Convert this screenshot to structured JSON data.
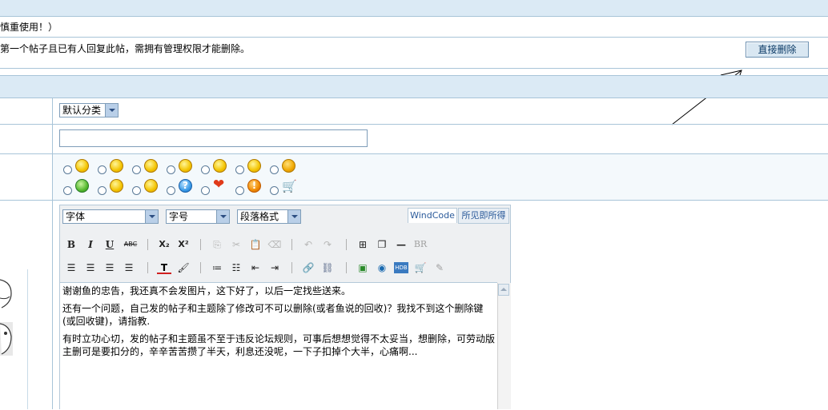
{
  "notice": {
    "line1": "慎重使用！）",
    "line2": "第一个帖子且已有人回复此帖，需拥有管理权限才能删除。",
    "delete_button": "直接删除"
  },
  "form": {
    "category_selected": "默认分类",
    "title_value": ""
  },
  "emoticons_row1": [
    "smile",
    "grin",
    "blush",
    "wink",
    "surprised",
    "laugh",
    "angry"
  ],
  "emoticons_row2": [
    "sick",
    "cry",
    "cool",
    "question",
    "heart",
    "warning",
    "cart"
  ],
  "editor": {
    "font_label": "字体",
    "size_label": "字号",
    "paragraph_label": "段落格式",
    "mode_windcode": "WindCode",
    "mode_wysiwyg": "所见即所得",
    "toolbar": {
      "bold": "B",
      "italic": "I",
      "underline": "U",
      "strike": "ABC",
      "subscript": "X₂",
      "superscript": "X²",
      "hr": "—",
      "br": "BR"
    },
    "content": [
      "谢谢鱼的忠告，我还真不会发图片，这下好了，以后一定找些送来。",
      "还有一个问题，自己发的帖子和主题除了修改可不可以删除(或者鱼说的回收)？我找不到这个删除键(或回收键)，请指教.",
      "有时立功心切，发的帖子和主题虽不至于违反论坛规则，可事后想想觉得不太妥当，想删除，可劳动版主删可是要扣分的，辛辛苦苦攒了半天，利息还没呢，一下子扣掉个大半，心痛啊..."
    ]
  },
  "colors": {
    "header_bar": "#dbeaf5",
    "border": "#a8c4d8",
    "button_text": "#0b3a66"
  }
}
